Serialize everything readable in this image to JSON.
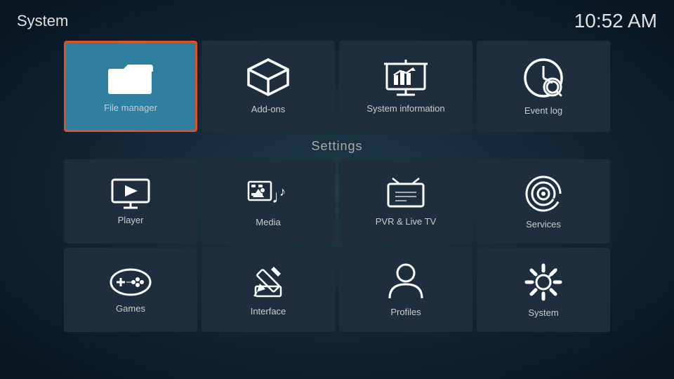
{
  "header": {
    "title": "System",
    "time": "10:52 AM"
  },
  "top_tiles": [
    {
      "id": "file-manager",
      "label": "File manager",
      "active": true
    },
    {
      "id": "add-ons",
      "label": "Add-ons",
      "active": false
    },
    {
      "id": "system-information",
      "label": "System information",
      "active": false
    },
    {
      "id": "event-log",
      "label": "Event log",
      "active": false
    }
  ],
  "settings_label": "Settings",
  "bottom_tiles_row1": [
    {
      "id": "player",
      "label": "Player"
    },
    {
      "id": "media",
      "label": "Media"
    },
    {
      "id": "pvr-live-tv",
      "label": "PVR & Live TV"
    },
    {
      "id": "services",
      "label": "Services"
    }
  ],
  "bottom_tiles_row2": [
    {
      "id": "games",
      "label": "Games"
    },
    {
      "id": "interface",
      "label": "Interface"
    },
    {
      "id": "profiles",
      "label": "Profiles"
    },
    {
      "id": "system",
      "label": "System"
    }
  ]
}
